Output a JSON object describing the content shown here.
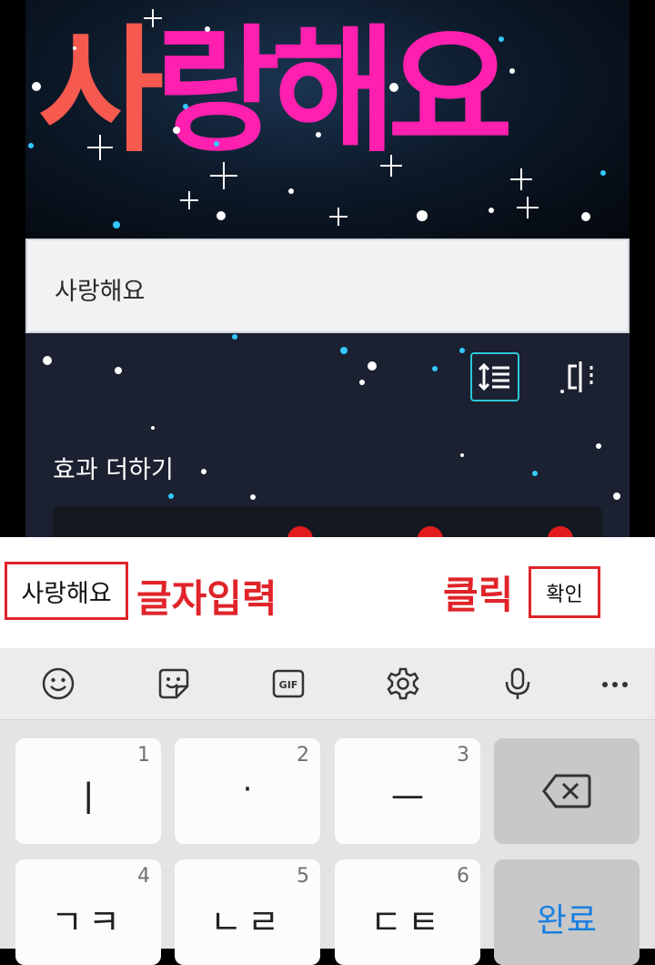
{
  "editor": {
    "preview_text_part1": "사",
    "preview_text_part2": "랑해요",
    "text_field_value": "사랑해요",
    "tools": {
      "line_spacing_icon": "line-spacing-icon",
      "align_icon": "text-align-icon"
    },
    "effects_label": "효과 더하기"
  },
  "annotation": {
    "input_box_text": "사랑해요",
    "input_caption": "글자입력",
    "click_caption": "클릭",
    "confirm_button": "확인"
  },
  "keyboard": {
    "toolbar": [
      "emoji-icon",
      "sticker-icon",
      "gif-icon",
      "settings-icon",
      "microphone-icon",
      "more-icon"
    ],
    "gif_label": "GIF",
    "keys": [
      {
        "label": "ㅣ",
        "num": "1"
      },
      {
        "label": "·",
        "num": "2"
      },
      {
        "label": "ㅡ",
        "num": "3"
      },
      {
        "label": "ㄱㅋ",
        "num": "4"
      },
      {
        "label": "ㄴㄹ",
        "num": "5"
      },
      {
        "label": "ㄷㅌ",
        "num": "6"
      }
    ],
    "done_label": "완료",
    "colors": {
      "done_text": "#1a7fe0",
      "highlight": "#e0242a",
      "active_tool": "#2ec7d6"
    }
  }
}
